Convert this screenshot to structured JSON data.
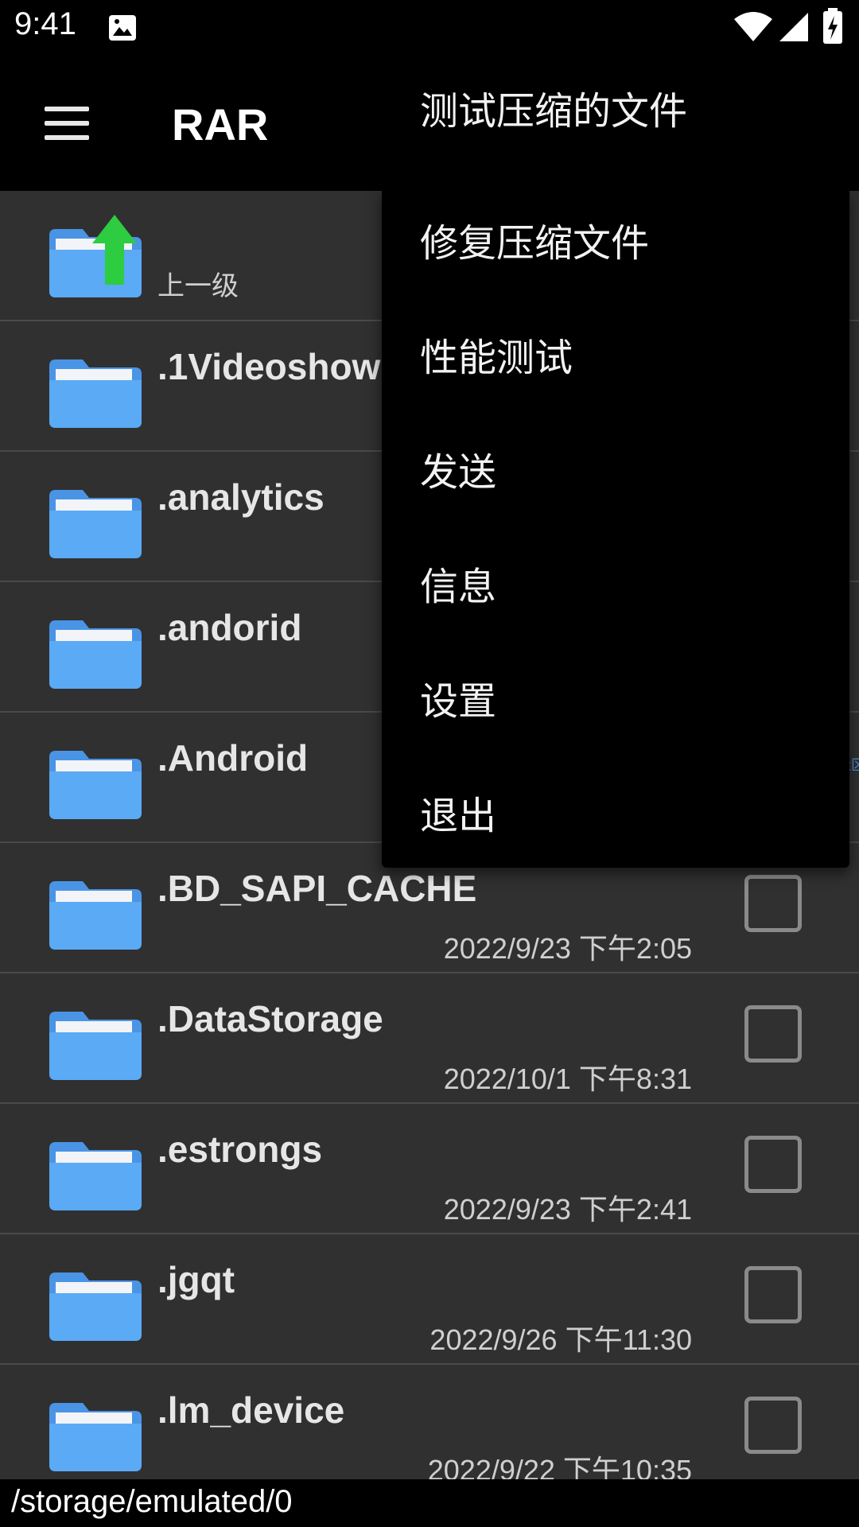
{
  "status_bar": {
    "time": "9:41"
  },
  "app_bar": {
    "title": "RAR"
  },
  "file_list": {
    "parent_label": "上一级",
    "items": [
      {
        "name": ".1Videoshow",
        "date": ""
      },
      {
        "name": ".analytics",
        "date": ""
      },
      {
        "name": ".andorid",
        "date": ""
      },
      {
        "name": ".Android",
        "date": ""
      },
      {
        "name": ".BD_SAPI_CACHE",
        "date": "2022/9/23 下午2:05"
      },
      {
        "name": ".DataStorage",
        "date": "2022/10/1 下午8:31"
      },
      {
        "name": ".estrongs",
        "date": "2022/9/23 下午2:41"
      },
      {
        "name": ".jgqt",
        "date": "2022/9/26 下午11:30"
      },
      {
        "name": ".lm_device",
        "date": "2022/9/22 下午10:35"
      }
    ]
  },
  "path_bar": {
    "path": "/storage/emulated/0"
  },
  "overflow_menu": {
    "items": [
      {
        "label": "测试压缩的文件"
      },
      {
        "label": "修复压缩文件"
      },
      {
        "label": "性能测试"
      },
      {
        "label": "发送"
      },
      {
        "label": "信息"
      },
      {
        "label": "设置"
      },
      {
        "label": "退出"
      }
    ]
  },
  "watermark": "流星社区",
  "colors": {
    "background": "#303030",
    "bar": "#000000",
    "folder": "#5aaaf5",
    "folder_tab": "#4a94e6",
    "up_arrow": "#2ecc40"
  }
}
